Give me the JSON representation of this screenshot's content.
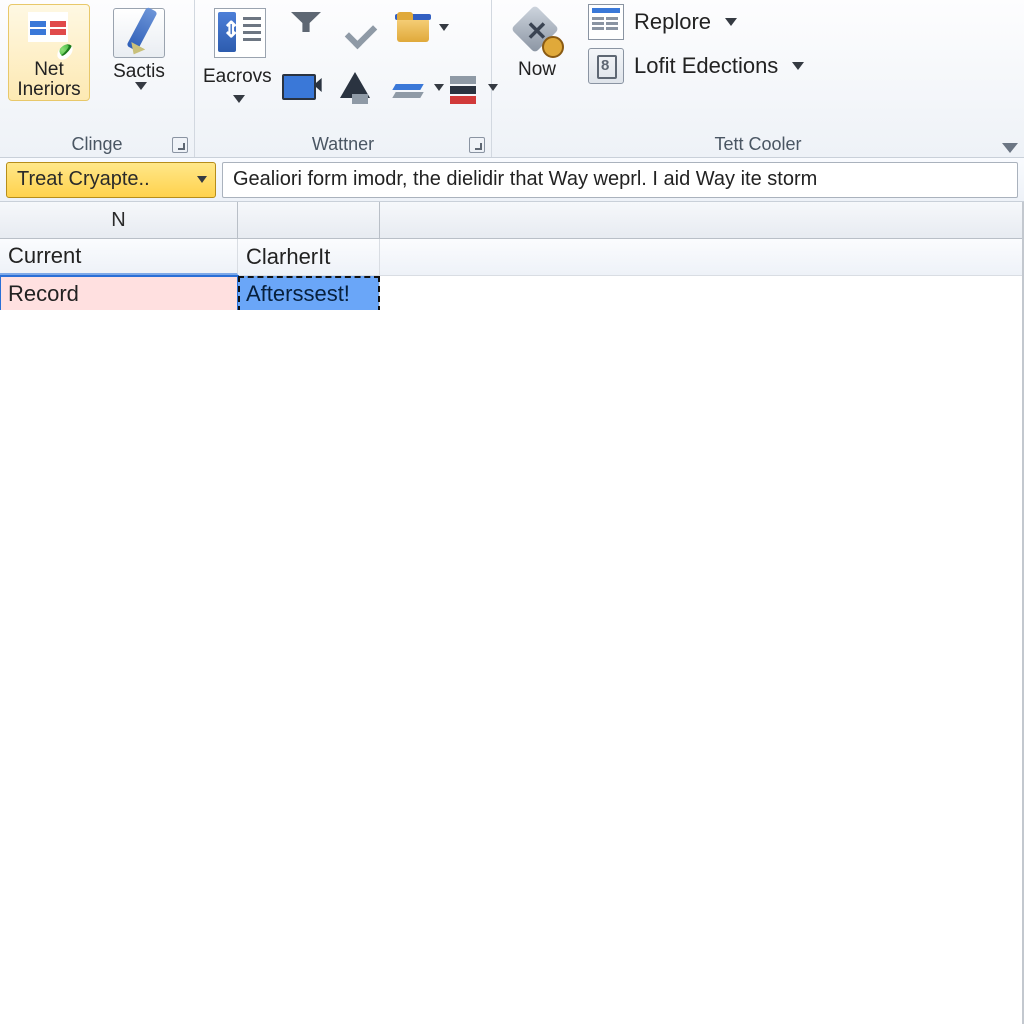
{
  "ribbon": {
    "groups": {
      "clinge": {
        "label": "Clinge",
        "net_ineriors": "Net\nIneriors",
        "sactis": "Sactis"
      },
      "wattner": {
        "label": "Wattner",
        "eacrovs": "Eacrovs"
      },
      "tett_cooler": {
        "label": "Tett Cooler",
        "now": "Now",
        "replore": "Replore",
        "lofit": "Lofit Edections"
      }
    }
  },
  "formula_bar": {
    "name_box": "Treat Cryapte..",
    "formula": "Gealiori form imodr, the dielidir that Way weprl. I aid Way ite storm"
  },
  "grid": {
    "col_header": "N",
    "rows": [
      {
        "a": "Current",
        "b": "ClarherIt"
      },
      {
        "a": "Record",
        "b": "Afterssest!"
      }
    ]
  }
}
